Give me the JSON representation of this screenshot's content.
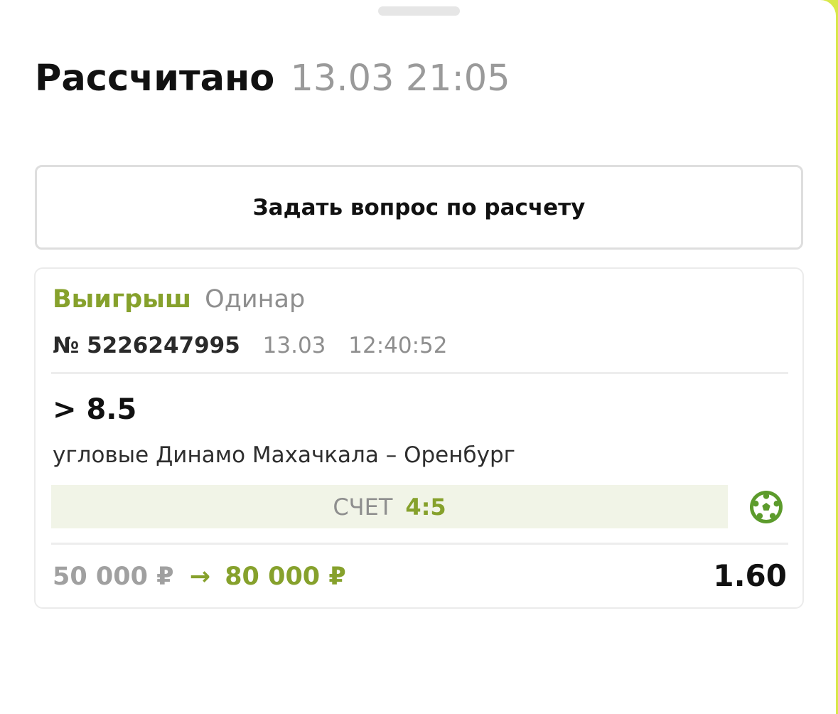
{
  "header": {
    "status": "Рассчитано",
    "datetime": "13.03 21:05"
  },
  "ask_button": {
    "label": "Задать вопрос по расчету"
  },
  "bet": {
    "result": "Выигрыш",
    "bet_type": "Одинар",
    "number": "№ 5226247995",
    "date": "13.03",
    "time": "12:40:52",
    "outcome": "> 8.5",
    "event": "угловые Динамо Махачкала – Оренбург",
    "score_label": "СЧЕТ",
    "score_value": "4:5",
    "sport_icon": "soccer-ball-icon",
    "stake": "50 000 ₽",
    "arrow": "→",
    "payout": "80 000 ₽",
    "odds": "1.60"
  },
  "colors": {
    "accent": "#86a12c",
    "score_bg": "#f1f4e7",
    "edge": "#d9e84a"
  }
}
